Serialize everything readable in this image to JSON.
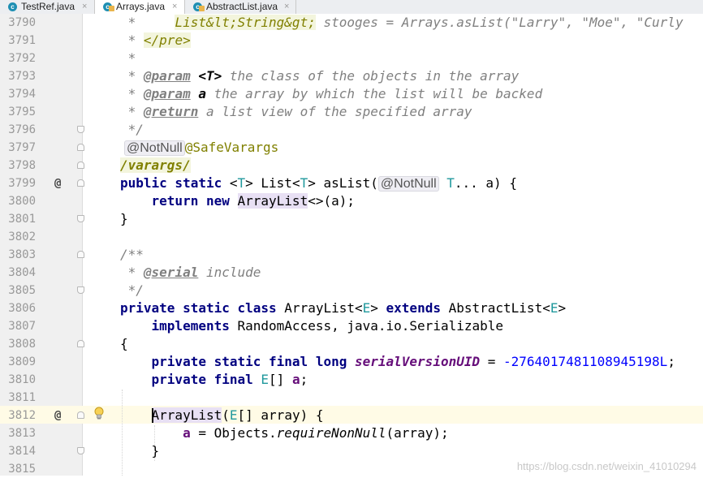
{
  "tabs": [
    {
      "label": "TestRef.java",
      "close": "×",
      "icon": "class-file-icon",
      "active": false
    },
    {
      "label": "Arrays.java",
      "close": "×",
      "icon": "class-file-icon",
      "active": true
    },
    {
      "label": "AbstractList.java",
      "close": "×",
      "icon": "class-file-icon",
      "active": false
    }
  ],
  "editor": {
    "line_numbers": [
      "3790",
      "3791",
      "3792",
      "3793",
      "3794",
      "3795",
      "3796",
      "3797",
      "3798",
      "3799",
      "3800",
      "3801",
      "3802",
      "3803",
      "3804",
      "3805",
      "3806",
      "3807",
      "3808",
      "3809",
      "3810",
      "3811",
      "3812",
      "3813",
      "3814",
      "3815"
    ],
    "gutter_marks": {
      "override_3799": "@",
      "override_3812": "@"
    },
    "current_line": "3812"
  },
  "code": {
    "l3790": {
      "a": " *     ",
      "b": "List&lt;String&gt;",
      "c": " stooges = Arrays.asList(\"Larry\", \"Moe\", \"Curly"
    },
    "l3791": {
      "a": " * ",
      "b": "</pre>"
    },
    "l3792": {
      "a": " *"
    },
    "l3793": {
      "a": " * ",
      "tag": "@param",
      "b": " ",
      "name": "<T>",
      "c": " the class of the objects in the array"
    },
    "l3794": {
      "a": " * ",
      "tag": "@param",
      "b": " ",
      "name": "a",
      "c": " the array by which the list will be backed"
    },
    "l3795": {
      "a": " * ",
      "tag": "@return",
      "c": " a list view of the specified array"
    },
    "l3796": {
      "a": " */"
    },
    "l3797": {
      "nn": "@NotNull",
      "ann": "@SafeVarargs"
    },
    "l3798": {
      "a": "/varargs/"
    },
    "l3799": {
      "kw1": "public static ",
      "p1": "<",
      "t": "T",
      "p2": "> List<",
      "t2": "T",
      "p3": "> asList(",
      "nn": "@NotNull",
      "t3": " T",
      "p4": "... a) {"
    },
    "l3800": {
      "indent": "    ",
      "kw": "return new ",
      "hl": "ArrayList",
      "rest": "<>(a);"
    },
    "l3801": {
      "a": "}"
    },
    "l3803": {
      "a": "/**"
    },
    "l3804": {
      "a": " * ",
      "tag": "@serial",
      "c": " include"
    },
    "l3805": {
      "a": " */"
    },
    "l3806": {
      "kw": "private static class ",
      "n": "ArrayList<",
      "t": "E",
      "p": "> ",
      "kw2": "extends",
      "n2": " AbstractList<",
      "t2": "E",
      "p2": ">"
    },
    "l3807": {
      "indent": "    ",
      "kw": "implements",
      "rest": " RandomAccess, java.io.Serializable"
    },
    "l3808": {
      "a": "{"
    },
    "l3809": {
      "indent": "    ",
      "kw": "private static final long ",
      "fld": "serialVersionUID",
      "eq": " = ",
      "num": "-2764017481108945198L",
      "end": ";"
    },
    "l3810": {
      "indent": "    ",
      "kw": "private final ",
      "t": "E",
      "br": "[] ",
      "fld": "a",
      "end": ";"
    },
    "l3812": {
      "indent": "    ",
      "hl": "ArrayList",
      "p": "(",
      "t": "E",
      "rest": "[] array) {"
    },
    "l3813": {
      "indent": "        ",
      "fld": "a",
      "eq": " = Objects.",
      "st": "requireNonNull",
      "rest": "(array);"
    },
    "l3814": {
      "indent": "    ",
      "a": "}"
    }
  },
  "watermark": "https://blog.csdn.net/weixin_41010294",
  "icons": {
    "intention": "lightbulb-icon",
    "fold": "fold-marker-icon",
    "override": "override-marker-icon"
  }
}
